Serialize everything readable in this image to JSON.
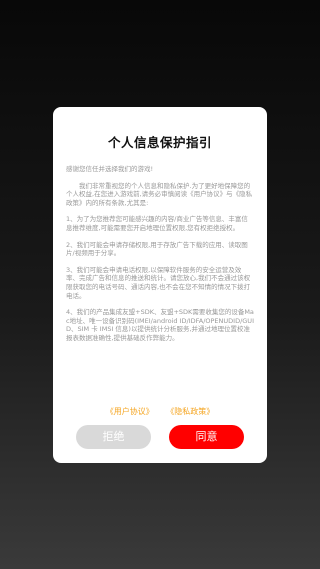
{
  "dialog": {
    "title": "个人信息保护指引",
    "greeting": "感谢您信任并选择我们的游戏!",
    "intro": "我们非常重视您的个人信息和隐私保护.为了更好地保障您的个人权益,在您进入游戏前,请务必审慎阅读《用户协议》与《隐私政策》内的所有条款,尤其是:",
    "items": [
      "1、为了为您推荐您可能感兴趣的内容/商业广告等信息、丰富信息推荐维度,可能需要您开启地理位置权限,您有权拒绝授权。",
      "2、我们可能会申请存储权限,用于存放广告下载的应用、读取图片/视频用于分享。",
      "3、我们可能会申请电话权限,以保障软件服务的安全运营及效率、完成广告和信息的推送和统计。请您放心,我们不会通过该权限获取您的电话号码、通话内容,也不会在您不知情的情况下拨打电话。",
      "4、我们的产品集成友盟+SDK、友盟+SDK需要收集您的设备Mac地址、唯一设备识别码(IMEI/android ID/IDFA/OPENUDID/GUID、SIM 卡 IMSI 信息)以提供统计分析服务,并通过地理位置校准报表数据准确性,提供基础反作弊能力。"
    ],
    "link_user_agreement": "《用户协议》",
    "link_privacy_policy": "《隐私政策》",
    "reject_label": "拒绝",
    "agree_label": "同意"
  },
  "colors": {
    "link": "#f5a623",
    "agree_button": "#ff0000",
    "reject_button": "#d9d9d9"
  }
}
